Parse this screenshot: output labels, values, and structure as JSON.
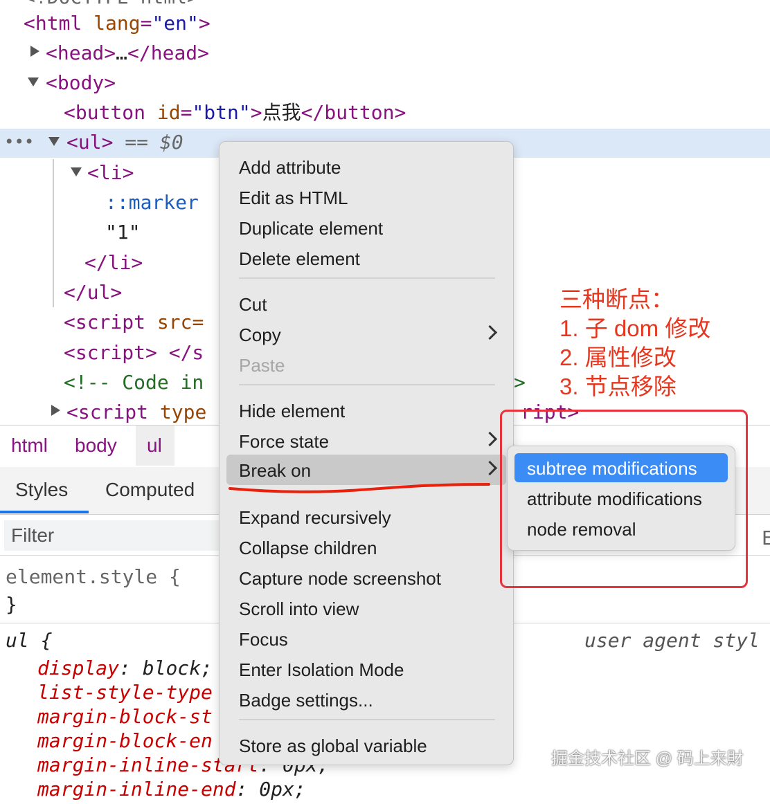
{
  "dom_tree": {
    "line_top": "<!DOCTYPE html>",
    "html_tag": "<html",
    "html_attr": "lang",
    "html_val": "\"en\"",
    "head_open": "<head>",
    "head_ell": "…",
    "head_close": "</head>",
    "body_tag": "<body>",
    "button_open": "<button",
    "button_attr": "id",
    "button_val": "\"btn\"",
    "button_text": "点我",
    "button_close": "</button>",
    "ul_tag": "<ul>",
    "ul_ref": "== $0",
    "li_tag": "<li>",
    "marker": "::marker",
    "text_node": "\"1\"",
    "li_close": "</li>",
    "ul_close": "</ul>",
    "script1": "<script",
    "script1_attr": "src=",
    "script2": "<script> </s",
    "comment": "<!-- Code in",
    "comment_end": ">",
    "script3": "<script",
    "script3_attr": "type",
    "script3_end": "ript>",
    "ellipsis_icon": "more-icon"
  },
  "breadcrumbs": [
    "html",
    "body",
    "ul"
  ],
  "tabs": [
    "Styles",
    "Computed"
  ],
  "filter": {
    "placeholder": "Filter"
  },
  "styles": {
    "element_style": "element.style {",
    "element_close": "}",
    "ul_selector": "ul {",
    "user_agent": "user agent styl",
    "props": [
      {
        "name": "display",
        "value": ": block;"
      },
      {
        "name": "list-style-type",
        "value": ""
      },
      {
        "name": "margin-block-st",
        "value": ""
      },
      {
        "name": "margin-block-en",
        "value": ""
      },
      {
        "name": "margin-inline-start",
        "value": ": 0px;"
      },
      {
        "name": "margin-inline-end",
        "value": ": 0px;"
      }
    ]
  },
  "context_menu": {
    "groups": [
      [
        "Add attribute",
        "Edit as HTML",
        "Duplicate element",
        "Delete element"
      ],
      [
        "Cut",
        "Copy",
        "Paste"
      ],
      [
        "Hide element",
        "Force state",
        "Break on"
      ],
      [
        "Expand recursively",
        "Collapse children",
        "Capture node screenshot",
        "Scroll into view",
        "Focus",
        "Enter Isolation Mode",
        "Badge settings..."
      ],
      [
        "Store as global variable"
      ]
    ],
    "submenu_items": [
      "Copy",
      "Force state",
      "Break on"
    ],
    "disabled_items": [
      "Paste"
    ],
    "hovered_item": "Break on"
  },
  "break_on_submenu": {
    "items": [
      "subtree modifications",
      "attribute modifications",
      "node removal"
    ],
    "active": "subtree modifications"
  },
  "annotation": {
    "lines": [
      "三种断点：",
      "1. 子 dom 修改",
      "2. 属性修改",
      "3. 节点移除"
    ],
    "color": "#e6361e"
  },
  "watermark": "掘金技术社区 @ 码上来財",
  "colors": {
    "selection_row": "#dbe8f7",
    "menu_bg": "#e8e8e8",
    "submenu_active": "#3b8cf5",
    "annotation_box": "#e8333d"
  }
}
